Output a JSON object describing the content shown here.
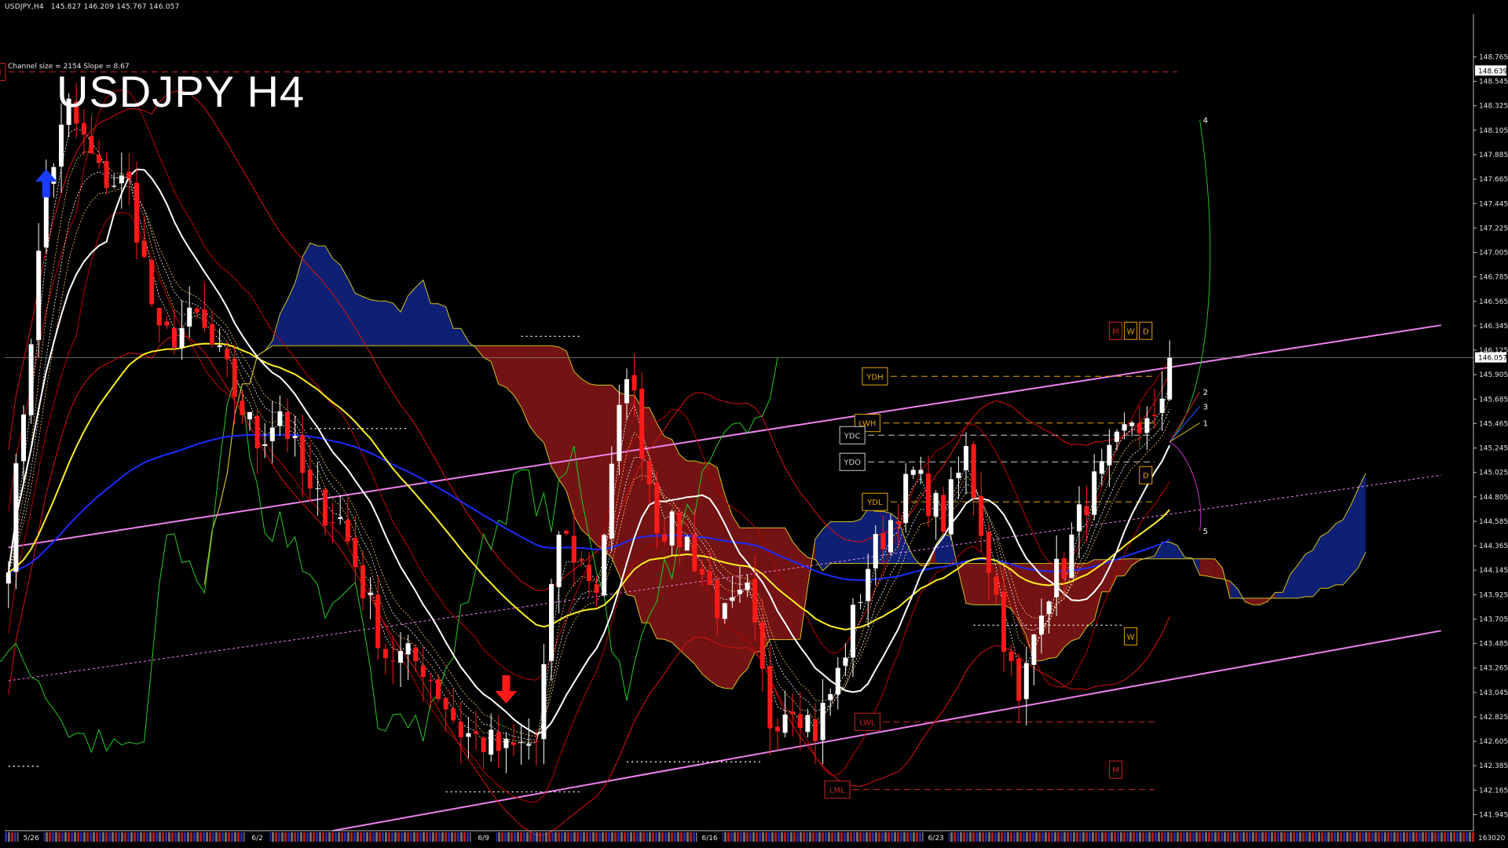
{
  "header": {
    "symbol_info": "USDJPY,H4",
    "ohlc": "145.827 146.209 145.767 146.057",
    "channel_info": "Channel size = 2154 Slope = 8.67",
    "title": "USDJPY H4"
  },
  "colors": {
    "background": "#000000",
    "bull": "#ffffff",
    "bear": "#ff1a1a",
    "channel": "#ee82ee",
    "ma_white": "#ffffff",
    "ma_yellow": "#ffee22",
    "ma_blue": "#1a2cff",
    "chikou": "#22cc22",
    "envelope": "#dd1111",
    "kumo_edge": "#d4c020",
    "kumo_bull": "#1e48ff",
    "kumo_bear": "#ff2a2a",
    "level_orange": "#e7a300",
    "level_red": "#cc2222"
  },
  "chart_data": {
    "type": "candlestick",
    "symbol": "USDJPY",
    "timeframe": "H4",
    "current_price": 146.057,
    "ylim": [
      141.8,
      149.15
    ],
    "y_ticks": [
      "148.765",
      "148.545",
      "148.325",
      "148.105",
      "147.885",
      "147.665",
      "147.445",
      "147.225",
      "147.005",
      "146.785",
      "146.565",
      "146.345",
      "146.125",
      "145.905",
      "145.685",
      "145.465",
      "145.245",
      "145.025",
      "144.805",
      "144.585",
      "144.365",
      "144.145",
      "143.925",
      "143.705",
      "143.485",
      "143.265",
      "143.045",
      "142.825",
      "142.605",
      "142.385",
      "142.165",
      "141.945"
    ],
    "y_tick_values": [
      148.765,
      148.545,
      148.325,
      148.105,
      147.885,
      147.665,
      147.445,
      147.225,
      147.005,
      146.785,
      146.565,
      146.345,
      146.125,
      145.905,
      145.685,
      145.465,
      145.245,
      145.025,
      144.805,
      144.585,
      144.365,
      144.145,
      143.925,
      143.705,
      143.485,
      143.265,
      143.045,
      142.825,
      142.605,
      142.385,
      142.165,
      141.945
    ],
    "price_marker_top": "148.639",
    "price_marker_current": "146.057",
    "price_marker_top_value": 148.639,
    "date_labels": [
      "5/26",
      "6/2",
      "6/9",
      "6/16",
      "6/23"
    ],
    "date_label_bars": [
      3,
      33,
      63,
      93,
      123
    ],
    "volume_label": "163020",
    "bar_count": 155,
    "ohlc_anchors": [
      {
        "bar": 0,
        "price": 144.3
      },
      {
        "bar": 5,
        "price": 147.6
      },
      {
        "bar": 8,
        "price": 148.3
      },
      {
        "bar": 12,
        "price": 147.7
      },
      {
        "bar": 16,
        "price": 147.6
      },
      {
        "bar": 20,
        "price": 146.2
      },
      {
        "bar": 25,
        "price": 146.4
      },
      {
        "bar": 29,
        "price": 145.9
      },
      {
        "bar": 33,
        "price": 145.3
      },
      {
        "bar": 36,
        "price": 145.6
      },
      {
        "bar": 40,
        "price": 144.8
      },
      {
        "bar": 44,
        "price": 144.6
      },
      {
        "bar": 50,
        "price": 143.4
      },
      {
        "bar": 55,
        "price": 143.3
      },
      {
        "bar": 60,
        "price": 142.7
      },
      {
        "bar": 66,
        "price": 142.5
      },
      {
        "bar": 70,
        "price": 142.6
      },
      {
        "bar": 73,
        "price": 144.5
      },
      {
        "bar": 78,
        "price": 144.0
      },
      {
        "bar": 82,
        "price": 146.0
      },
      {
        "bar": 86,
        "price": 144.6
      },
      {
        "bar": 90,
        "price": 144.4
      },
      {
        "bar": 95,
        "price": 143.7
      },
      {
        "bar": 98,
        "price": 143.9
      },
      {
        "bar": 101,
        "price": 142.8
      },
      {
        "bar": 104,
        "price": 143.0
      },
      {
        "bar": 107,
        "price": 142.7
      },
      {
        "bar": 110,
        "price": 143.2
      },
      {
        "bar": 114,
        "price": 144.2
      },
      {
        "bar": 117,
        "price": 144.6
      },
      {
        "bar": 120,
        "price": 145.0
      },
      {
        "bar": 124,
        "price": 144.6
      },
      {
        "bar": 127,
        "price": 145.2
      },
      {
        "bar": 131,
        "price": 143.9
      },
      {
        "bar": 134,
        "price": 142.9
      },
      {
        "bar": 137,
        "price": 143.9
      },
      {
        "bar": 140,
        "price": 144.2
      },
      {
        "bar": 143,
        "price": 144.8
      },
      {
        "bar": 146,
        "price": 145.1
      },
      {
        "bar": 149,
        "price": 145.5
      },
      {
        "bar": 152,
        "price": 145.4
      },
      {
        "bar": 154,
        "price": 146.05
      }
    ],
    "markers": [
      {
        "type": "arrow_up",
        "bar": 5,
        "price": 147.6,
        "color": "#1a3cff"
      },
      {
        "type": "arrow_down",
        "bar": 66,
        "price": 143.1,
        "color": "#ff1a1a"
      }
    ],
    "levels": [
      {
        "label": "LMH",
        "price": 148.63,
        "color": "#cc2222",
        "style": "dashed",
        "x0_bar": 0,
        "x1_bar": 155
      },
      {
        "label": "YDH",
        "price": 145.89,
        "color": "#e7a300",
        "style": "dashed",
        "x0_bar": 117,
        "x1_bar": 152
      },
      {
        "label": "LWH",
        "price": 145.47,
        "color": "#e7a300",
        "style": "dashed",
        "x0_bar": 116,
        "x1_bar": 152
      },
      {
        "label": "YDC",
        "price": 145.36,
        "color": "#cccccc",
        "style": "dashed",
        "x0_bar": 114,
        "x1_bar": 152
      },
      {
        "label": "YDO",
        "price": 145.12,
        "color": "#cccccc",
        "style": "dashed",
        "x0_bar": 114,
        "x1_bar": 152
      },
      {
        "label": "YDL",
        "price": 144.76,
        "color": "#e7a300",
        "style": "dashed",
        "x0_bar": 117,
        "x1_bar": 152
      },
      {
        "label": "LWL",
        "price": 142.78,
        "color": "#cc2222",
        "style": "dashed",
        "x0_bar": 116,
        "x1_bar": 152
      },
      {
        "label": "LML",
        "price": 142.17,
        "color": "#cc2222",
        "style": "dashed",
        "x0_bar": 112,
        "x1_bar": 152
      }
    ],
    "tags": [
      {
        "label": "M",
        "bar": 146,
        "price": 146.3,
        "color": "#cc2222"
      },
      {
        "label": "W",
        "bar": 148,
        "price": 146.3,
        "color": "#e7a300"
      },
      {
        "label": "D",
        "bar": 150,
        "price": 146.3,
        "color": "#e7a300"
      },
      {
        "label": "D",
        "bar": 150,
        "price": 145.0,
        "color": "#e7a300"
      },
      {
        "label": "W",
        "bar": 148,
        "price": 143.55,
        "color": "#e7a300"
      },
      {
        "label": "M",
        "bar": 146,
        "price": 142.35,
        "color": "#cc2222"
      }
    ],
    "projection_labels": [
      {
        "label": "4",
        "bar": 158,
        "price": 148.2
      },
      {
        "label": "2",
        "bar": 158,
        "price": 145.75
      },
      {
        "label": "3",
        "bar": 158,
        "price": 145.62
      },
      {
        "label": "1",
        "bar": 158,
        "price": 145.47
      },
      {
        "label": "5",
        "bar": 158,
        "price": 144.5
      }
    ],
    "channel_lines": [
      {
        "bar0": 0,
        "price0": 144.35,
        "bar1": 190,
        "price1": 146.35
      },
      {
        "bar0": 43,
        "price0": 141.8,
        "bar1": 190,
        "price1": 143.6
      },
      {
        "bar0": 0,
        "price0": 143.15,
        "bar1": 190,
        "price1": 145.0,
        "dashed": true
      }
    ],
    "dotted_levels": [
      {
        "price": 146.25,
        "bar0": 68,
        "bar1": 76
      },
      {
        "price": 145.42,
        "bar0": 40,
        "bar1": 53
      },
      {
        "price": 143.65,
        "bar0": 128,
        "bar1": 148
      },
      {
        "price": 142.38,
        "bar0": 0,
        "bar1": 4
      },
      {
        "price": 142.42,
        "bar0": 82,
        "bar1": 100
      },
      {
        "price": 142.15,
        "bar0": 58,
        "bar1": 76
      }
    ]
  }
}
